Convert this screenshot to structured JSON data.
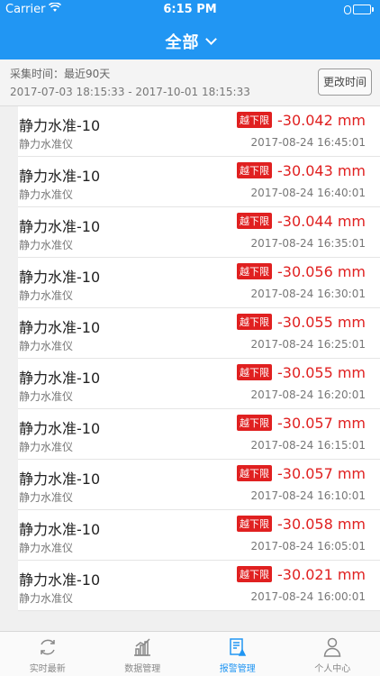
{
  "status_bar": {
    "carrier": "Carrier",
    "time": "6:15 PM"
  },
  "nav": {
    "title": "全部"
  },
  "filter": {
    "label": "采集时间：最近90天",
    "range": "2017-07-03 18:15:33 - 2017-10-01 18:15:33",
    "change_time_button": "更改时间"
  },
  "alerts": [
    {
      "name": "静力水准-10",
      "type": "静力水准仪",
      "badge": "越下限",
      "value": "-30.042 mm",
      "time": "2017-08-24 16:45:01"
    },
    {
      "name": "静力水准-10",
      "type": "静力水准仪",
      "badge": "越下限",
      "value": "-30.043 mm",
      "time": "2017-08-24 16:40:01"
    },
    {
      "name": "静力水准-10",
      "type": "静力水准仪",
      "badge": "越下限",
      "value": "-30.044 mm",
      "time": "2017-08-24 16:35:01"
    },
    {
      "name": "静力水准-10",
      "type": "静力水准仪",
      "badge": "越下限",
      "value": "-30.056 mm",
      "time": "2017-08-24 16:30:01"
    },
    {
      "name": "静力水准-10",
      "type": "静力水准仪",
      "badge": "越下限",
      "value": "-30.055 mm",
      "time": "2017-08-24 16:25:01"
    },
    {
      "name": "静力水准-10",
      "type": "静力水准仪",
      "badge": "越下限",
      "value": "-30.055 mm",
      "time": "2017-08-24 16:20:01"
    },
    {
      "name": "静力水准-10",
      "type": "静力水准仪",
      "badge": "越下限",
      "value": "-30.057 mm",
      "time": "2017-08-24 16:15:01"
    },
    {
      "name": "静力水准-10",
      "type": "静力水准仪",
      "badge": "越下限",
      "value": "-30.057 mm",
      "time": "2017-08-24 16:10:01"
    },
    {
      "name": "静力水准-10",
      "type": "静力水准仪",
      "badge": "越下限",
      "value": "-30.058 mm",
      "time": "2017-08-24 16:05:01"
    },
    {
      "name": "静力水准-10",
      "type": "静力水准仪",
      "badge": "越下限",
      "value": "-30.021 mm",
      "time": "2017-08-24 16:00:01"
    }
  ],
  "tabs": [
    {
      "label": "实时最新",
      "icon": "refresh-icon",
      "active": false
    },
    {
      "label": "数据管理",
      "icon": "bar-chart-icon",
      "active": false
    },
    {
      "label": "报警管理",
      "icon": "alarm-report-icon",
      "active": true
    },
    {
      "label": "个人中心",
      "icon": "person-icon",
      "active": false
    }
  ],
  "colors": {
    "primary": "#2196f3",
    "alert": "#e02020"
  }
}
